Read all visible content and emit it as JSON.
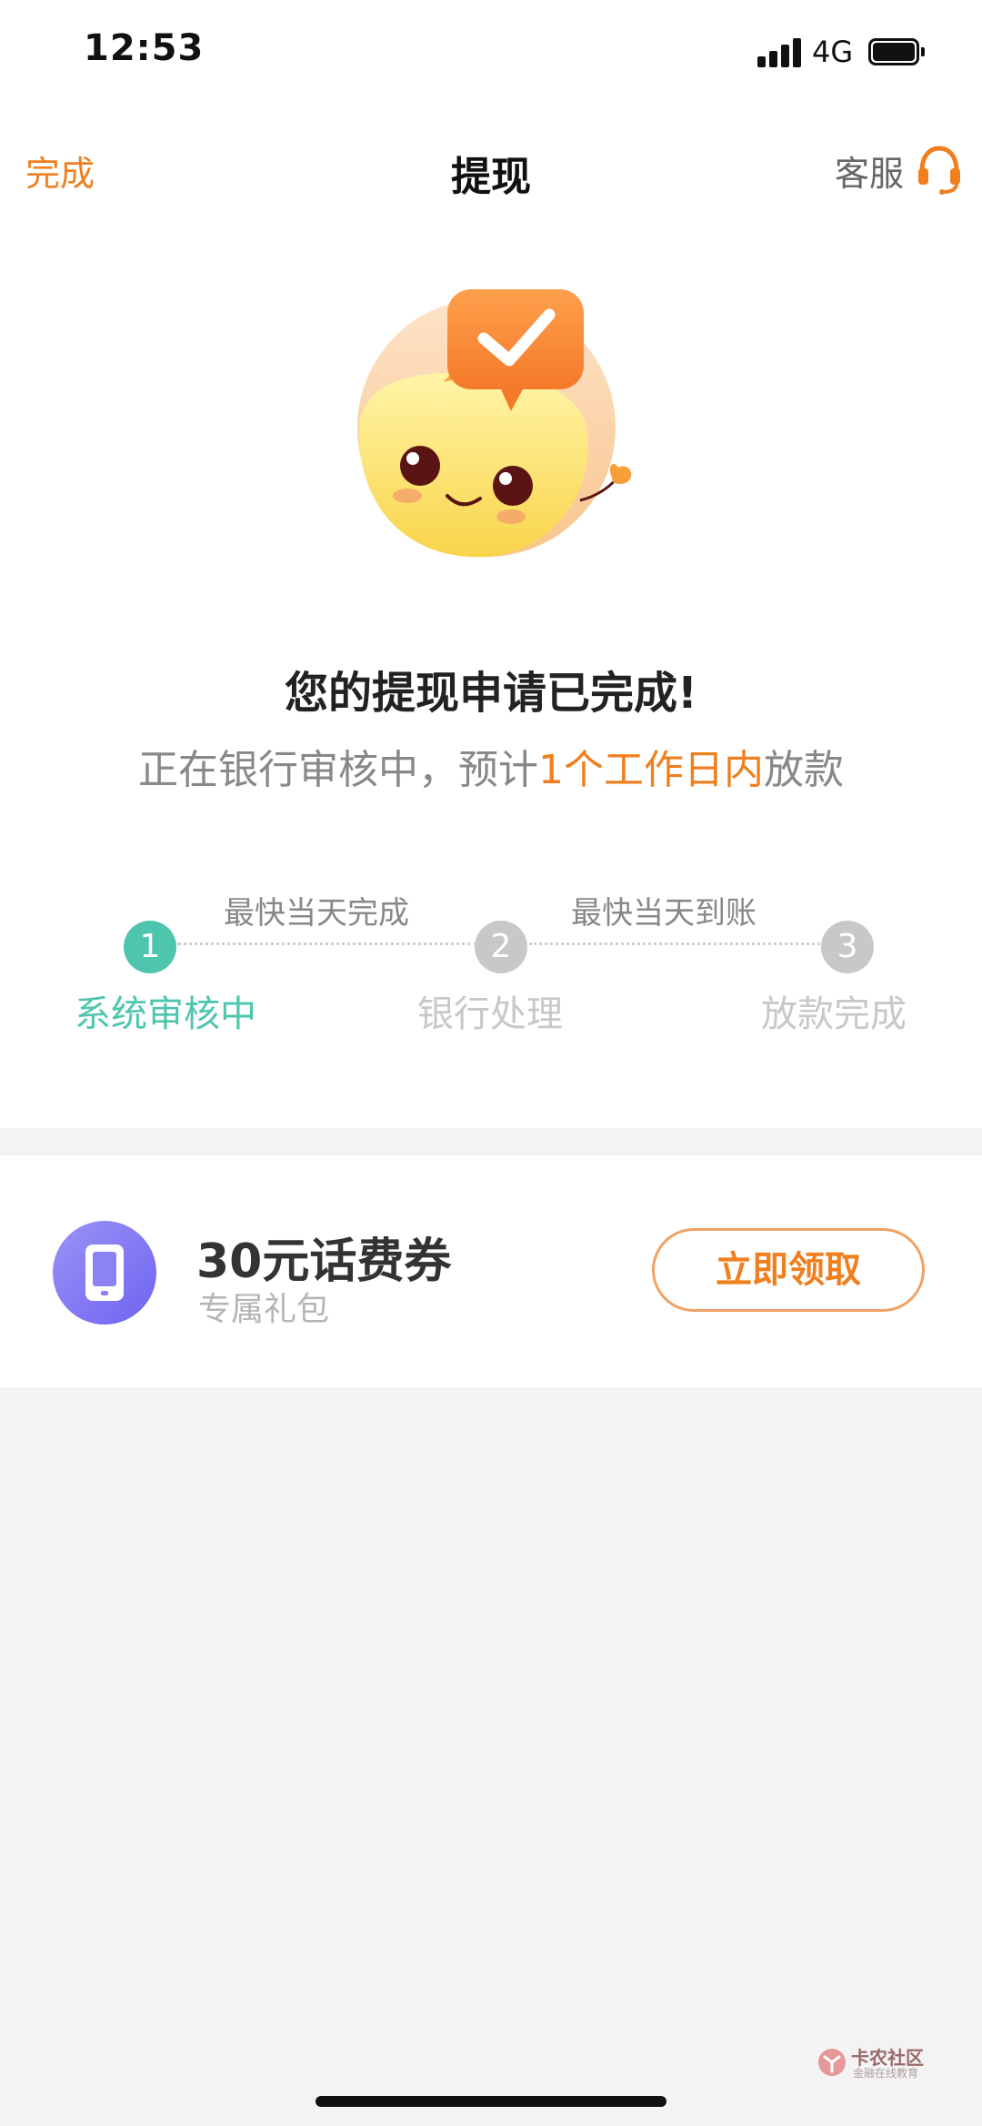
{
  "status_bar": {
    "time": "12:53",
    "network": "4G"
  },
  "nav": {
    "done": "完成",
    "title": "提现",
    "service": "客服",
    "service_icon": "headset-icon"
  },
  "result": {
    "title": "您的提现申请已完成!",
    "sub_before": "正在银行审核中，预计",
    "sub_highlight": "1个工作日内",
    "sub_after": "放款"
  },
  "steps": {
    "notes": [
      "最快当天完成",
      "最快当天到账"
    ],
    "items": [
      {
        "number": "1",
        "label": "系统审核中",
        "state": "active"
      },
      {
        "number": "2",
        "label": "银行处理",
        "state": "pending"
      },
      {
        "number": "3",
        "label": "放款完成",
        "state": "pending"
      }
    ]
  },
  "coupon": {
    "icon": "phone-icon",
    "title": "30元话费券",
    "subtitle": "专属礼包",
    "button": "立即领取"
  },
  "watermark": {
    "title": "卡农社区",
    "subtitle": "金融在线教育"
  },
  "colors": {
    "accent": "#f07f1f",
    "active_step": "#4ec6ae",
    "pending_step": "#c8c8c8",
    "coupon_icon": "#7f74f2"
  }
}
